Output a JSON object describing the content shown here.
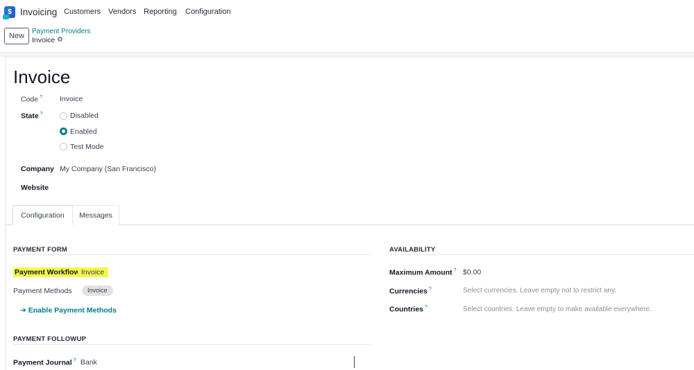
{
  "nav": {
    "app_name": "Invoicing",
    "menu": [
      "Customers",
      "Vendors",
      "Reporting",
      "Configuration"
    ],
    "logo_icon": "invoicing-app-icon"
  },
  "control_panel": {
    "new_label": "New",
    "breadcrumb_parent": "Payment Providers",
    "breadcrumb_current": "Invoice",
    "gear_icon": "gear-icon"
  },
  "record": {
    "title": "Invoice",
    "code_label": "Code",
    "code_value": "Invoice",
    "state_label": "State",
    "state_options": [
      "Disabled",
      "Enabled",
      "Test Mode"
    ],
    "state_selected": "Enabled",
    "company_label": "Company",
    "company_value": "My Company (San Francisco)",
    "website_label": "Website",
    "tooltip_mark": "?"
  },
  "tabs": [
    "Configuration",
    "Messages"
  ],
  "payment_form": {
    "section": "PAYMENT FORM",
    "workflow_label": "Payment Workflow",
    "workflow_value": "Invoice",
    "methods_label": "Payment Methods",
    "methods_badge": "Invoice",
    "enable_link": "Enable Payment Methods"
  },
  "availability": {
    "section": "AVAILABILITY",
    "max_amount_label": "Maximum Amount",
    "max_amount_value": "$0.00",
    "currencies_label": "Currencies",
    "currencies_placeholder": "Select currencies. Leave empty not to restrict any.",
    "countries_label": "Countries",
    "countries_placeholder": "Select countries. Leave empty to make available everywhere."
  },
  "payment_followup": {
    "section": "PAYMENT FOLLOWUP",
    "journal_label": "Payment Journal",
    "journal_value": "Bank"
  },
  "colors": {
    "accent": "#017e84",
    "brand": "#714b67",
    "highlight": "#f4f84a"
  }
}
